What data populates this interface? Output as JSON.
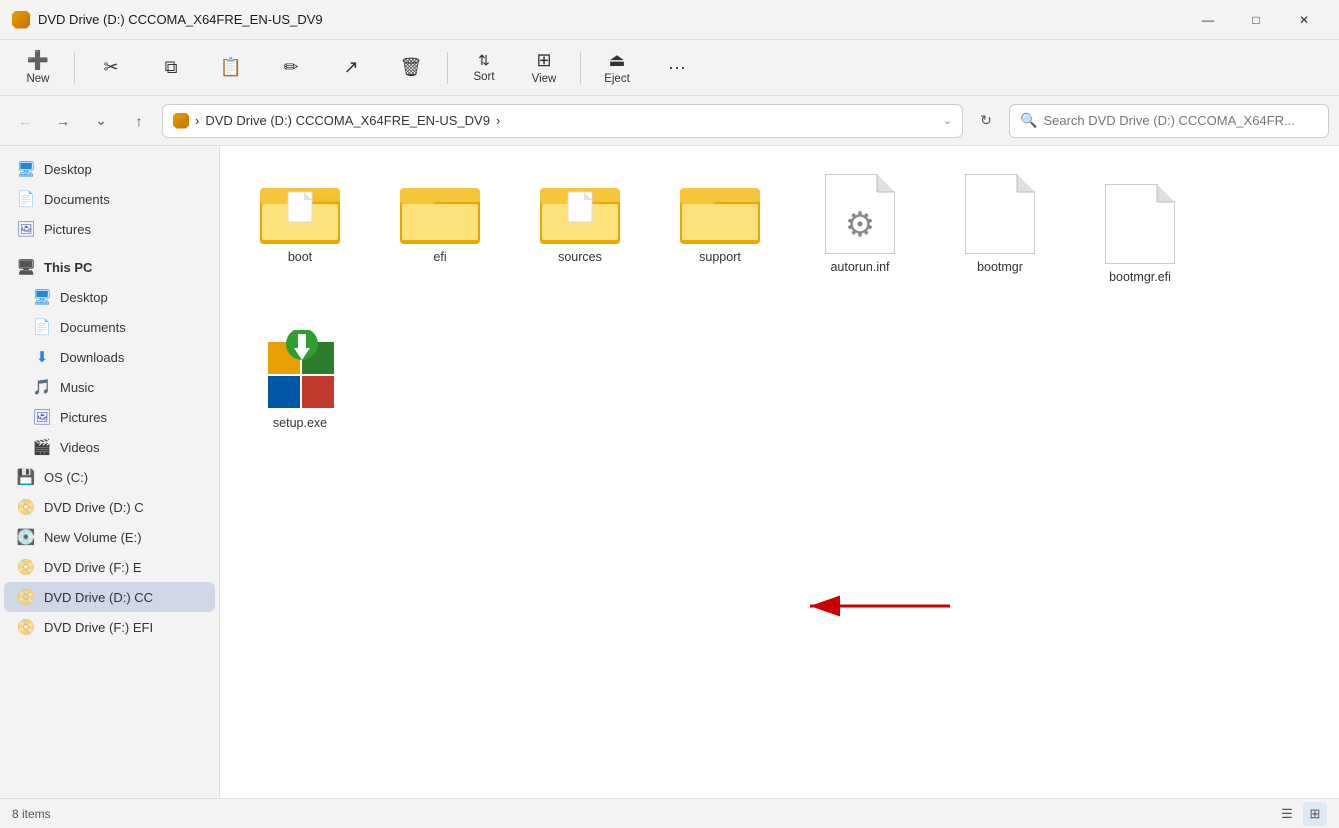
{
  "titlebar": {
    "icon": "dvd-icon",
    "title": "DVD Drive (D:) CCCOMA_X64FRE_EN-US_DV9",
    "minimize": "—",
    "maximize": "□",
    "close": "✕"
  },
  "toolbar": {
    "new_label": "New",
    "cut_label": "",
    "copy_label": "",
    "paste_label": "",
    "rename_label": "",
    "share_label": "",
    "delete_label": "",
    "sort_label": "Sort",
    "view_label": "View",
    "eject_label": "Eject",
    "more_label": "···"
  },
  "addressbar": {
    "path_icon": "dvd-icon",
    "breadcrumb": "DVD Drive (D:) CCCOMA_X64FRE_EN-US_DV9",
    "search_placeholder": "Search DVD Drive (D:) CCCOMA_X64FR..."
  },
  "sidebar": {
    "quick_access": [
      {
        "id": "desktop-qa",
        "label": "Desktop",
        "icon": "🖥"
      },
      {
        "id": "documents-qa",
        "label": "Documents",
        "icon": "📄"
      },
      {
        "id": "pictures-qa",
        "label": "Pictures",
        "icon": "🖼"
      }
    ],
    "this_pc_header": "This PC",
    "this_pc_items": [
      {
        "id": "desktop-pc",
        "label": "Desktop",
        "icon": "🖥"
      },
      {
        "id": "documents-pc",
        "label": "Documents",
        "icon": "📄"
      },
      {
        "id": "downloads-pc",
        "label": "Downloads",
        "icon": "⬇"
      },
      {
        "id": "music-pc",
        "label": "Music",
        "icon": "🎵"
      },
      {
        "id": "pictures-pc",
        "label": "Pictures",
        "icon": "🖼"
      },
      {
        "id": "videos-pc",
        "label": "Videos",
        "icon": "🎬"
      }
    ],
    "drives": [
      {
        "id": "os-c",
        "label": "OS (C:)",
        "icon": "💾"
      },
      {
        "id": "dvd-d",
        "label": "DVD Drive (D:) C",
        "icon": "📀"
      },
      {
        "id": "new-vol-e",
        "label": "New Volume (E:)",
        "icon": "💽"
      },
      {
        "id": "dvd-f",
        "label": "DVD Drive (F:) E",
        "icon": "📀"
      }
    ],
    "active_drive": {
      "id": "dvd-d-active",
      "label": "DVD Drive (D:) CC",
      "icon": "📀"
    },
    "more_drive": {
      "id": "dvd-f-more",
      "label": "DVD Drive (F:) EFI",
      "icon": "📀"
    }
  },
  "content": {
    "folders": [
      {
        "id": "boot",
        "label": "boot",
        "type": "folder-doc"
      },
      {
        "id": "efi",
        "label": "efi",
        "type": "folder-plain"
      },
      {
        "id": "sources",
        "label": "sources",
        "type": "folder-doc"
      },
      {
        "id": "support",
        "label": "support",
        "type": "folder-plain"
      }
    ],
    "files": [
      {
        "id": "autorun",
        "label": "autorun.inf",
        "type": "gear-file"
      },
      {
        "id": "bootmgr",
        "label": "bootmgr",
        "type": "generic-file"
      },
      {
        "id": "bootmgr-efi",
        "label": "bootmgr.efi",
        "type": "generic-file"
      },
      {
        "id": "setup",
        "label": "setup.exe",
        "type": "setup-exe"
      }
    ]
  },
  "statusbar": {
    "item_count": "8 items"
  }
}
